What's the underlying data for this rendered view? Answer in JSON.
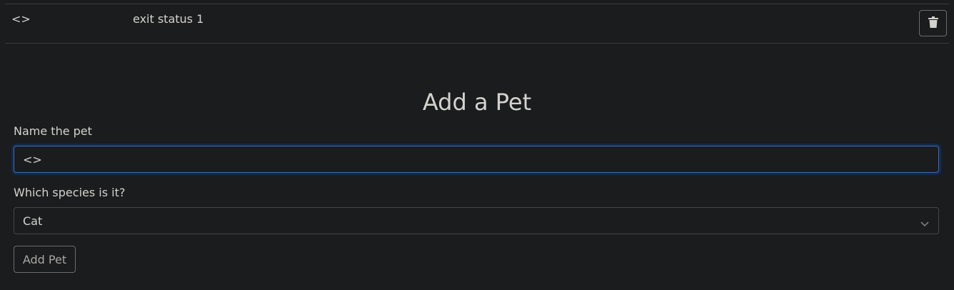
{
  "pet_list": {
    "items": [
      {
        "name": "<>",
        "status": "exit status 1"
      }
    ],
    "delete_icon": "trash-icon"
  },
  "form": {
    "title": "Add a Pet",
    "name_label": "Name the pet",
    "name_value": "<>",
    "species_label": "Which species is it?",
    "species_value": "Cat",
    "submit_label": "Add Pet"
  },
  "colors": {
    "background": "#1b1c1e",
    "text": "#d4d2cd",
    "focus_border": "#3f6db0"
  }
}
